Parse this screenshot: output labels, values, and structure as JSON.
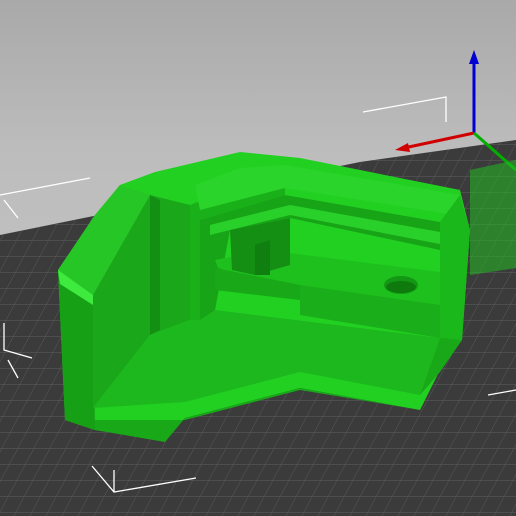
{
  "view": {
    "background_color": "#b8b8b8",
    "bed_color": "#3c3c3c",
    "bed_grid_color": "#5a5a5a",
    "model_color": "#22cc22",
    "model_shadow_color": "#169616",
    "model_highlight_color": "#33e233",
    "axis_x_color": "#cc0000",
    "axis_y_color": "#00aa00",
    "axis_z_color": "#0000cc",
    "bounding_box_color": "#ffffff"
  },
  "objects": [
    {
      "name": "corner-bracket-model",
      "icon": "3d-model"
    }
  ]
}
